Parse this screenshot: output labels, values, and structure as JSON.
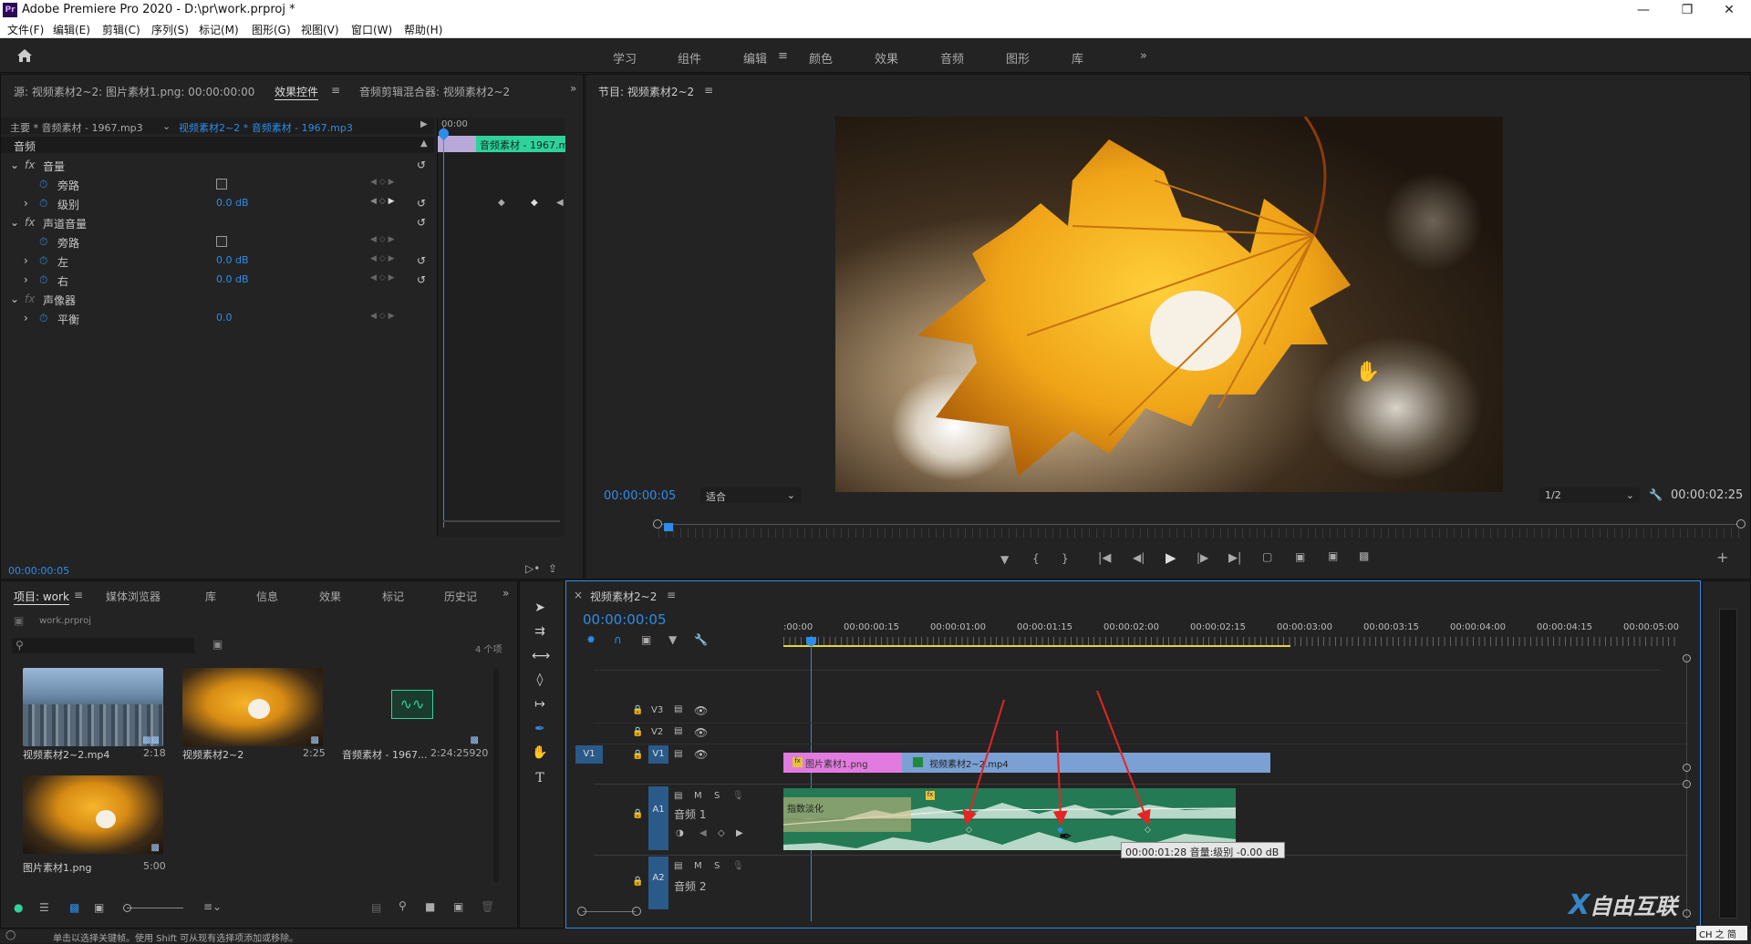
{
  "app": {
    "title": "Adobe Premiere Pro 2020 - D:\\pr\\work.prproj *",
    "logo": "Pr"
  },
  "menu": [
    "文件(F)",
    "编辑(E)",
    "剪辑(C)",
    "序列(S)",
    "标记(M)",
    "图形(G)",
    "视图(V)",
    "窗口(W)",
    "帮助(H)"
  ],
  "workspaces": [
    "学习",
    "组件",
    "编辑",
    "颜色",
    "效果",
    "音频",
    "图形",
    "库"
  ],
  "source_panel": {
    "tab_source": "源: 视频素材2~2: 图片素材1.png: 00:00:00:00",
    "tab_effects": "效果控件",
    "tab_mixer": "音频剪辑混合器: 视频素材2~2",
    "master": "主要 * 音频素材 - 1967.mp3",
    "clip": "视频素材2~2 * 音频素材 - 1967.mp3",
    "mini_time": "00:00",
    "mini_clip": "音频素材 - 1967.m",
    "section": "音频",
    "timecode": "00:00:00:05"
  },
  "effects": [
    {
      "type": "fx",
      "label": "音量"
    },
    {
      "type": "prop",
      "label": "旁路",
      "value": ""
    },
    {
      "type": "prop",
      "label": "级别",
      "value": "0.0 dB"
    },
    {
      "type": "fx",
      "label": "声道音量"
    },
    {
      "type": "prop",
      "label": "旁路",
      "value": ""
    },
    {
      "type": "prop",
      "label": "左",
      "value": "0.0 dB"
    },
    {
      "type": "prop",
      "label": "右",
      "value": "0.0 dB"
    },
    {
      "type": "fx",
      "label": "声像器"
    },
    {
      "type": "prop",
      "label": "平衡",
      "value": "0.0"
    }
  ],
  "program": {
    "title": "节目: 视频素材2~2",
    "timecode": "00:00:00:05",
    "fit": "适合",
    "quality": "1/2",
    "duration": "00:00:02:25"
  },
  "project": {
    "tabs": [
      "项目: work",
      "媒体浏览器",
      "库",
      "信息",
      "效果",
      "标记",
      "历史记"
    ],
    "file": "work.prproj",
    "count": "4 个项",
    "items": [
      {
        "name": "视频素材2~2.mp4",
        "dur": "2:18"
      },
      {
        "name": "视频素材2~2",
        "dur": "2:25"
      },
      {
        "name": "音频素材 - 1967...",
        "dur": "2:24:25920"
      },
      {
        "name": "图片素材1.png",
        "dur": "5:00"
      }
    ]
  },
  "timeline": {
    "title": "视频素材2~2",
    "timecode": "00:00:00:05",
    "ruler": [
      ":00:00",
      "00:00:00:15",
      "00:00:01:00",
      "00:00:01:15",
      "00:00:02:00",
      "00:00:02:15",
      "00:00:03:00",
      "00:00:03:15",
      "00:00:04:00",
      "00:00:04:15",
      "00:00:05:00"
    ],
    "tracks": {
      "v3": "V3",
      "v2": "V2",
      "v1": "V1",
      "a1": "A1",
      "a2": "A2",
      "src_v": "V1",
      "audio1": "音频 1",
      "audio2": "音频 2",
      "m": "M",
      "s": "S"
    },
    "clips": {
      "img": "图片素材1.png",
      "vid": "视频素材2~2.mp4",
      "fade": "指数淡化",
      "fxmark": "fx",
      "fxmark2": "fx"
    },
    "tooltip": "00:00:01:28  音量:级别  -0.00 dB"
  },
  "status": "单击以选择关键帧。使用 Shift 可从现有选择项添加或移除。",
  "watermark": {
    "brand": "自由互联",
    "ime": "CH 之 简"
  }
}
